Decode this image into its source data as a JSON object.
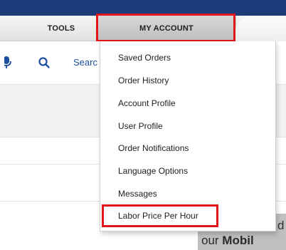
{
  "nav": {
    "tools_label": "TOOLS",
    "account_label": "MY ACCOUNT"
  },
  "search": {
    "label": "Searc"
  },
  "account_menu": {
    "items": [
      {
        "label": "Saved Orders"
      },
      {
        "label": "Order History"
      },
      {
        "label": "Account Profile"
      },
      {
        "label": "User Profile"
      },
      {
        "label": "Order Notifications"
      },
      {
        "label": "Language Options"
      },
      {
        "label": "Messages"
      },
      {
        "label": "Labor Price Per Hour"
      }
    ]
  },
  "banner": {
    "line1_tail": "d",
    "line2_prefix": "our ",
    "line2_bold": "Mobil"
  },
  "colors": {
    "header_blue": "#1b3c78",
    "highlight_red": "#e0161b",
    "link_blue": "#1d4f9e"
  },
  "icons": [
    "microphone-icon",
    "search-icon"
  ]
}
